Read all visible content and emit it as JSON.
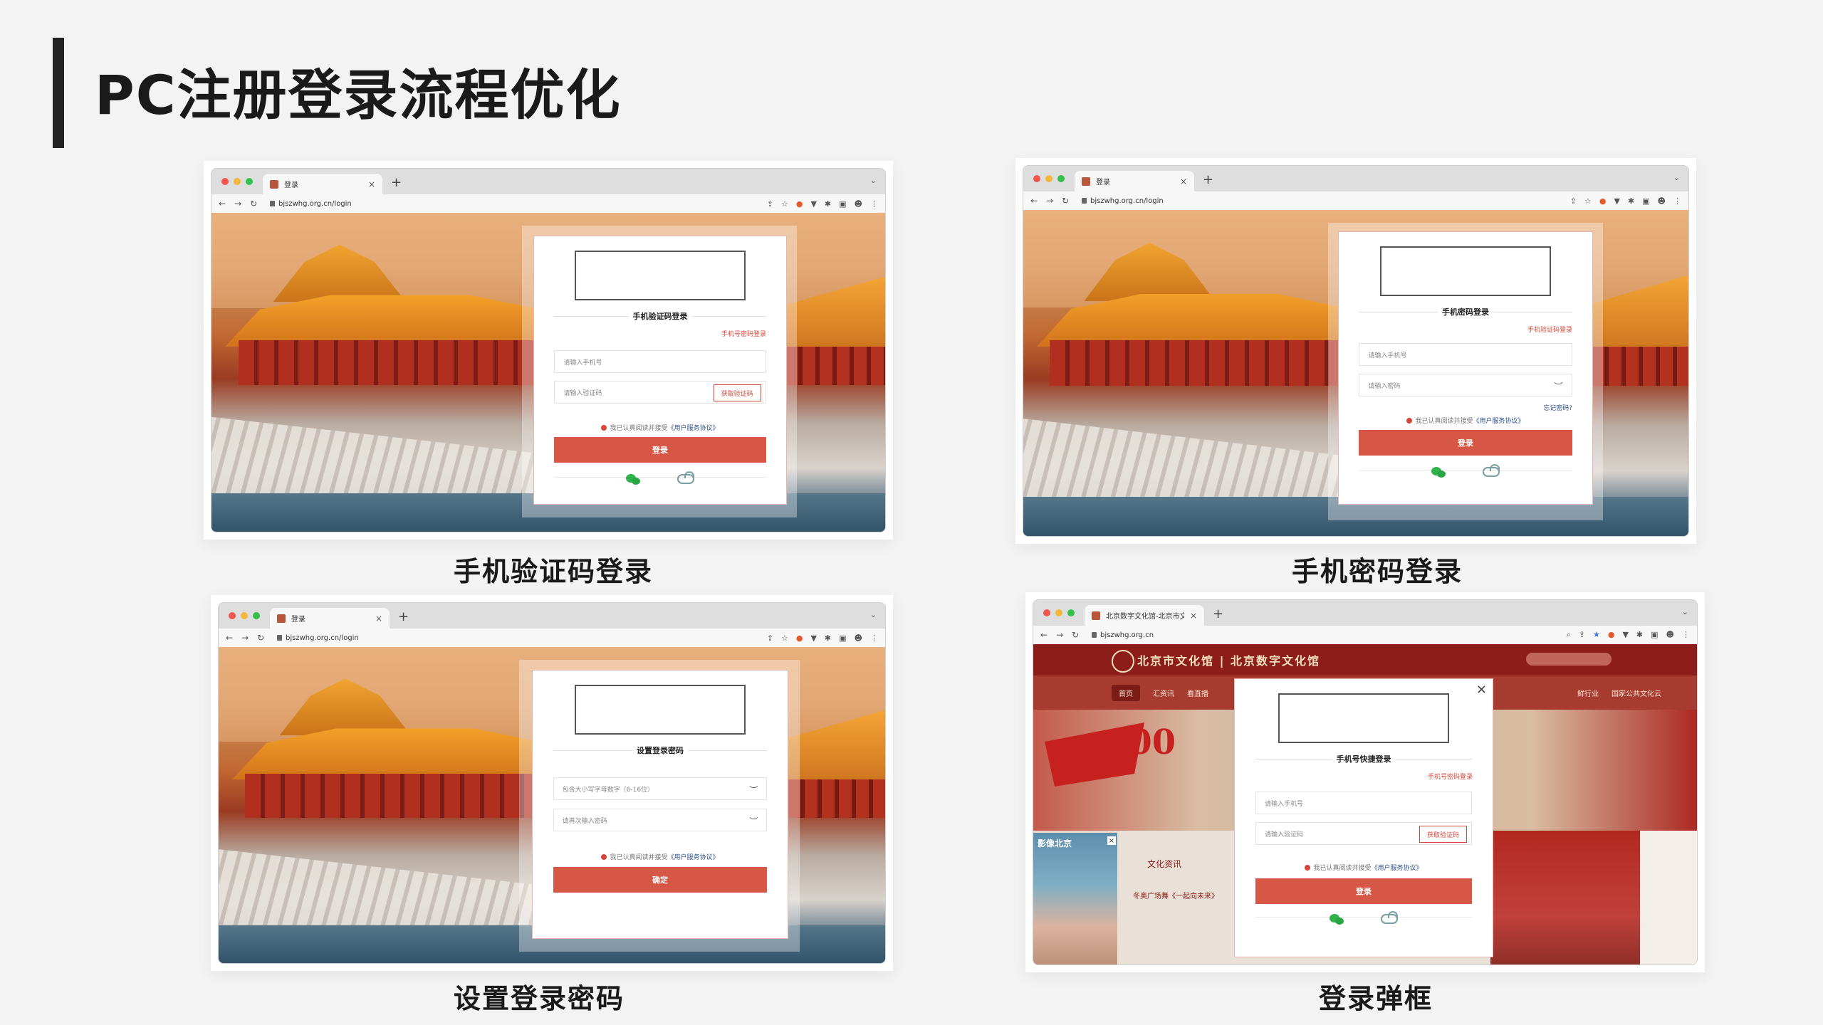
{
  "page": {
    "title": "PC注册登录流程优化"
  },
  "browser": {
    "url_login": "bjszwhg.org.cn/login",
    "url_home": "bjszwhg.org.cn",
    "tab_login": "登录",
    "tab_home": "北京数字文化馆-北京市文化馆"
  },
  "captions": {
    "sms_login": "手机验证码登录",
    "password_login": "手机密码登录",
    "set_password": "设置登录密码",
    "popup_login": "登录弹框"
  },
  "sms_card": {
    "title": "手机验证码登录",
    "switch": "手机号密码登录",
    "phone_placeholder": "请输入手机号",
    "code_placeholder": "请输入验证码",
    "code_button": "获取验证码",
    "agree_prefix": "我已认真阅读并接受",
    "agree_link": "《用户服务协议》",
    "submit": "登录"
  },
  "password_card": {
    "title": "手机密码登录",
    "switch": "手机验证码登录",
    "phone_placeholder": "请输入手机号",
    "password_placeholder": "请输入密码",
    "forgot": "忘记密码?",
    "agree_prefix": "我已认真阅读并接受",
    "agree_link": "《用户服务协议》",
    "submit": "登录"
  },
  "setpwd_card": {
    "title": "设置登录密码",
    "password_placeholder": "包含大小写字母数字（6-16位）",
    "confirm_placeholder": "请再次输入密码",
    "agree_prefix": "我已认真阅读并接受",
    "agree_link": "《用户服务协议》",
    "submit": "确定"
  },
  "popup_card": {
    "title": "手机号快捷登录",
    "switch": "手机号密码登录",
    "phone_placeholder": "请输入手机号",
    "code_placeholder": "请输入验证码",
    "code_button": "获取验证码",
    "agree_prefix": "我已认真阅读并接受",
    "agree_link": "《用户服务协议》",
    "submit": "登录"
  },
  "site": {
    "brand": "北京市文化馆 | 北京数字文化馆",
    "nav": [
      "首页",
      "汇资讯",
      "看直播",
      "鲜行业",
      "国家公共文化云"
    ],
    "banner_number": "100",
    "section_title": "文化资讯",
    "side_ad_label": "影像北京",
    "news_line": "冬奥广场舞《一起向未来》"
  },
  "icons": {
    "wechat": "wechat-icon",
    "cloud": "culture-cloud-icon",
    "lock": "lock-icon"
  },
  "colors": {
    "primary": "#d75746",
    "link": "#2b4f8f",
    "site_red": "#8d1d1a"
  }
}
